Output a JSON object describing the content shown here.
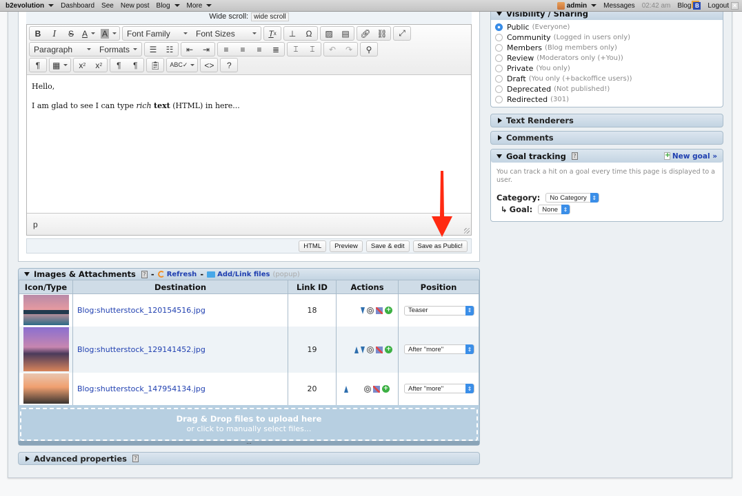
{
  "topbar": {
    "brand": "b2evolution",
    "items": [
      "Dashboard",
      "See",
      "New post",
      "Blog",
      "More"
    ],
    "user": "admin",
    "messages": "Messages",
    "time": "02:42 am",
    "blog": "Blog",
    "blog_badge": "B",
    "logout": "Logout"
  },
  "editor": {
    "wide_scroll_label": "Wide scroll:",
    "wide_scroll_value": "wide scroll",
    "toolbar": {
      "font_family": "Font Family",
      "font_sizes": "Font Sizes",
      "paragraph": "Paragraph",
      "formats": "Formats"
    },
    "content": {
      "line1": "Hello,",
      "line2_a": "I am glad to see I can type ",
      "line2_italic": "rich",
      "line2_bold": "text",
      "line2_b": " (HTML) in here..."
    },
    "path": "p",
    "buttons": {
      "html": "HTML",
      "preview": "Preview",
      "save_edit": "Save & edit",
      "save_public": "Save as Public!"
    }
  },
  "visibility": {
    "title": "Visibility / Sharing",
    "selected": "Public",
    "options": [
      {
        "label": "Public",
        "note": "(Everyone)"
      },
      {
        "label": "Community",
        "note": "(Logged in users only)"
      },
      {
        "label": "Members",
        "note": "(Blog members only)"
      },
      {
        "label": "Review",
        "note": "(Moderators only (+You))"
      },
      {
        "label": "Private",
        "note": "(You only)"
      },
      {
        "label": "Draft",
        "note": "(You only (+backoffice users))"
      },
      {
        "label": "Deprecated",
        "note": "(Not published!)"
      },
      {
        "label": "Redirected",
        "note": "(301)"
      }
    ]
  },
  "panels": {
    "text_renderers": "Text Renderers",
    "comments": "Comments",
    "advanced": "Advanced properties"
  },
  "goal": {
    "title": "Goal tracking",
    "new_goal": "New goal »",
    "desc": "You can track a hit on a goal every time this page is displayed to a user.",
    "category_label": "Category:",
    "category_value": "No Category",
    "goal_label": "Goal:",
    "goal_value": "None"
  },
  "attachments": {
    "title": "Images & Attachments",
    "refresh": "Refresh",
    "add_link": "Add/Link files",
    "popup": "(popup)",
    "columns": [
      "Icon/Type",
      "Destination",
      "Link ID",
      "Actions",
      "Position"
    ],
    "rows": [
      {
        "file": "Blog:shutterstock_120154516.jpg",
        "link_id": "18",
        "position": "Teaser"
      },
      {
        "file": "Blog:shutterstock_129141452.jpg",
        "link_id": "19",
        "position": "After \"more\""
      },
      {
        "file": "Blog:shutterstock_147954134.jpg",
        "link_id": "20",
        "position": "After \"more\""
      }
    ],
    "drop_title": "Drag & Drop files to upload here",
    "drop_sub": "or click to manually select files...",
    "handle": "..."
  },
  "colors": {
    "accent": "#1f3fb0",
    "annotation_arrow": "#ff2a12",
    "radio_on": "#3a8ee8"
  }
}
